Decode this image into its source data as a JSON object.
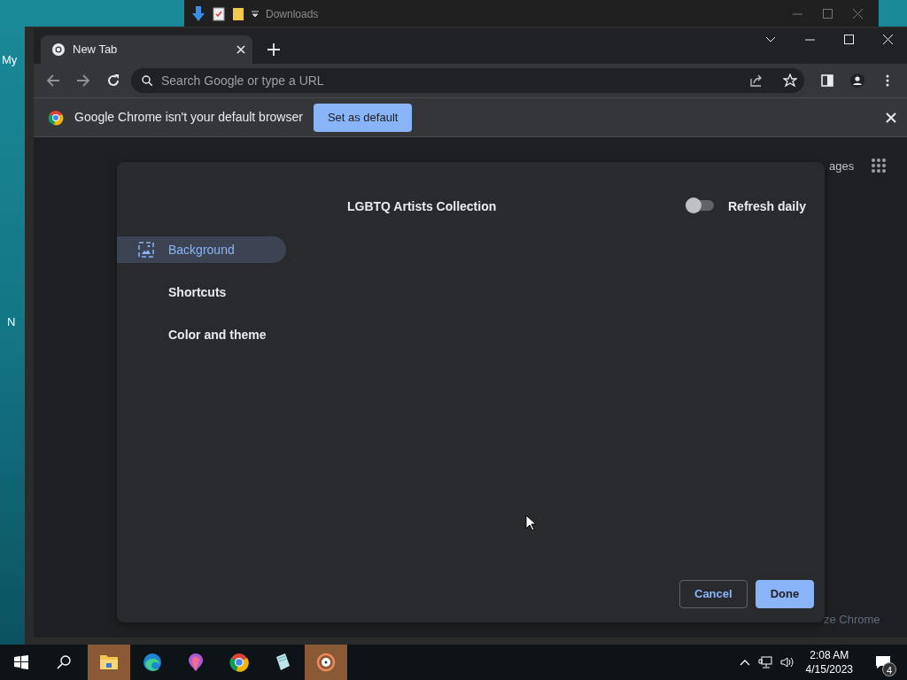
{
  "desktop": {
    "icon_labels": [
      "My",
      "N"
    ]
  },
  "explorer_window": {
    "title": "Downloads"
  },
  "browser": {
    "tabs": [
      {
        "title": "New Tab",
        "selected": true
      }
    ],
    "omnibox": {
      "placeholder": "Search Google or type a URL"
    },
    "infobar": {
      "message": "Google Chrome isn't your default browser",
      "button": "Set as default"
    },
    "new_tab_page": {
      "top_link": "ages",
      "customize_link": "ze Chrome"
    }
  },
  "dialog": {
    "title": "LGBTQ Artists Collection",
    "refresh_daily": {
      "label": "Refresh daily",
      "on": false
    },
    "nav": [
      {
        "label": "Background",
        "selected": true,
        "kind": "background"
      },
      {
        "label": "Shortcuts",
        "selected": false,
        "kind": "plain"
      },
      {
        "label": "Color and theme",
        "selected": false,
        "kind": "plain"
      }
    ],
    "buttons": [
      {
        "label": "Cancel",
        "kind": "secondary"
      },
      {
        "label": "Done",
        "kind": "primary"
      }
    ]
  },
  "taskbar": {
    "apps": [
      {
        "kind": "folder",
        "highlighted": true
      },
      {
        "kind": "edge",
        "highlighted": false
      },
      {
        "kind": "paint",
        "highlighted": false
      },
      {
        "kind": "chrome",
        "highlighted": false
      },
      {
        "kind": "notes",
        "highlighted": false
      },
      {
        "kind": "music",
        "highlighted": true
      }
    ],
    "time": "2:08 AM",
    "date": "4/15/2023",
    "notifications": "4"
  }
}
